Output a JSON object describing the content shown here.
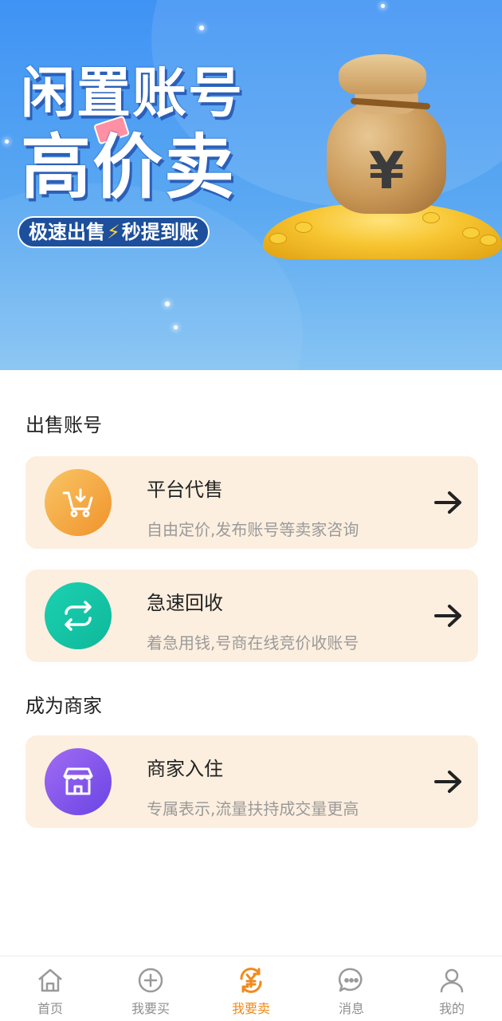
{
  "banner": {
    "headline_line1": "闲置账号",
    "headline_line2": "高价卖",
    "slogan_left": "极速出售",
    "slogan_right": "秒提到账",
    "bag_symbol": "¥"
  },
  "sections": [
    {
      "title": "出售账号",
      "cards": [
        {
          "title": "平台代售",
          "subtitle": "自由定价,发布账号等卖家咨询",
          "icon": "cart-icon",
          "color": "#f0932b"
        },
        {
          "title": "急速回收",
          "subtitle": "着急用钱,号商在线竞价收账号",
          "icon": "recycle-icon",
          "color": "#12c3a4"
        }
      ]
    },
    {
      "title": "成为商家",
      "cards": [
        {
          "title": "商家入住",
          "subtitle": "专属表示,流量扶持成交量更高",
          "icon": "store-icon",
          "color": "#8257ec"
        }
      ]
    }
  ],
  "tabbar": {
    "active_color": "#f08a1c",
    "items": [
      {
        "label": "首页",
        "icon": "home-icon"
      },
      {
        "label": "我要买",
        "icon": "plus-circle-icon"
      },
      {
        "label": "我要卖",
        "icon": "yen-cycle-icon",
        "active": true
      },
      {
        "label": "消息",
        "icon": "chat-icon"
      },
      {
        "label": "我的",
        "icon": "user-icon"
      }
    ]
  }
}
